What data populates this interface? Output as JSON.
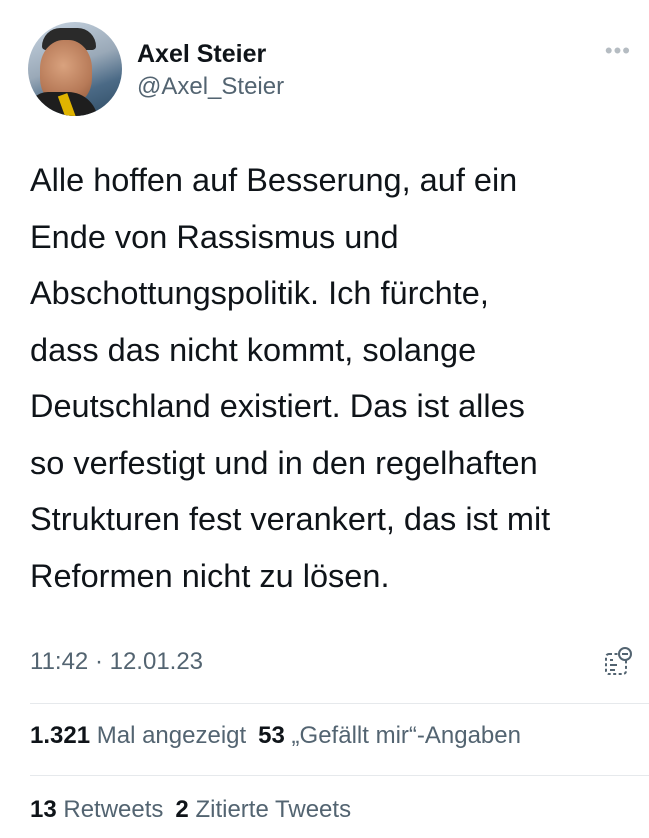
{
  "author": {
    "name": "Axel Steier",
    "handle": "@Axel_Steier",
    "avatar_icon": "profile-photo"
  },
  "tweet": {
    "lines": [
      "Alle hoffen auf Besserung, auf ein",
      "Ende von Rassismus und",
      "Abschottungspolitik. Ich fürchte,",
      "dass das nicht kommt, solange",
      "Deutschland existiert. Das ist alles",
      "so verfestigt und in den regelhaften",
      "Strukturen fest verankert, das ist mit",
      "Reformen nicht zu lösen."
    ],
    "timestamp": "11:42 · 12.01.23"
  },
  "stats": {
    "views_count": "1.321",
    "views_label": "Mal angezeigt",
    "likes_count": "53",
    "likes_label": "„Gefällt mir“-Angaben",
    "retweets_count": "13",
    "retweets_label": "Retweets",
    "quotes_count": "2",
    "quotes_label": "Zitierte Tweets"
  },
  "icons": {
    "more": "more-options-icon",
    "analytics": "view-analytics-icon"
  },
  "colors": {
    "text_primary": "#0f1419",
    "text_secondary": "#536471",
    "divider": "#e6e9ec"
  }
}
